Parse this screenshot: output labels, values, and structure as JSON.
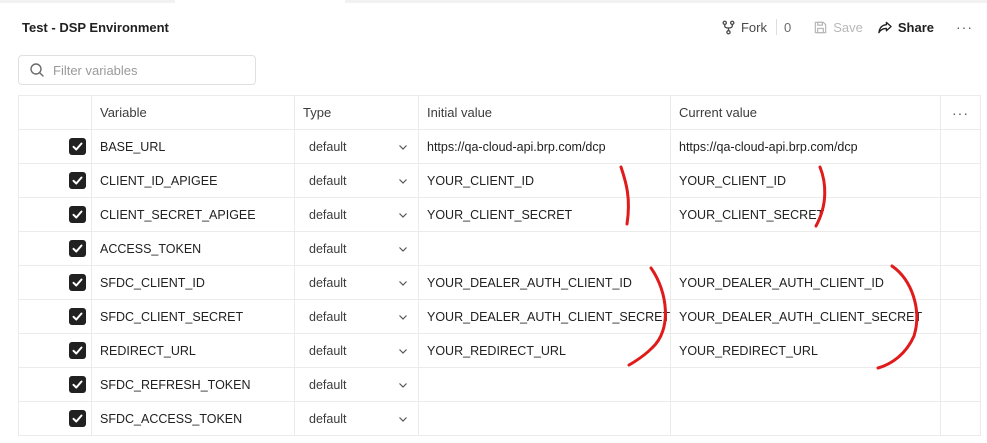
{
  "header": {
    "title": "Test - DSP Environment",
    "fork_label": "Fork",
    "fork_count": "0",
    "save_label": "Save",
    "share_label": "Share",
    "more_label": "···"
  },
  "filter": {
    "placeholder": "Filter variables",
    "value": ""
  },
  "table": {
    "headers": {
      "variable": "Variable",
      "type": "Type",
      "initial": "Initial value",
      "current": "Current value",
      "menu": "···"
    },
    "rows": [
      {
        "enabled": true,
        "name": "BASE_URL",
        "type": "default",
        "initial": "https://qa-cloud-api.brp.com/dcp",
        "current": "https://qa-cloud-api.brp.com/dcp"
      },
      {
        "enabled": true,
        "name": "CLIENT_ID_APIGEE",
        "type": "default",
        "initial": "YOUR_CLIENT_ID",
        "current": "YOUR_CLIENT_ID"
      },
      {
        "enabled": true,
        "name": "CLIENT_SECRET_APIGEE",
        "type": "default",
        "initial": "YOUR_CLIENT_SECRET",
        "current": "YOUR_CLIENT_SECRET"
      },
      {
        "enabled": true,
        "name": "ACCESS_TOKEN",
        "type": "default",
        "initial": "",
        "current": ""
      },
      {
        "enabled": true,
        "name": "SFDC_CLIENT_ID",
        "type": "default",
        "initial": "YOUR_DEALER_AUTH_CLIENT_ID",
        "current": "YOUR_DEALER_AUTH_CLIENT_ID"
      },
      {
        "enabled": true,
        "name": "SFDC_CLIENT_SECRET",
        "type": "default",
        "initial": "YOUR_DEALER_AUTH_CLIENT_SECRET",
        "current": "YOUR_DEALER_AUTH_CLIENT_SECRET"
      },
      {
        "enabled": true,
        "name": "REDIRECT_URL",
        "type": "default",
        "initial": "YOUR_REDIRECT_URL",
        "current": "YOUR_REDIRECT_URL"
      },
      {
        "enabled": true,
        "name": "SFDC_REFRESH_TOKEN",
        "type": "default",
        "initial": "",
        "current": ""
      },
      {
        "enabled": true,
        "name": "SFDC_ACCESS_TOKEN",
        "type": "default",
        "initial": "",
        "current": ""
      }
    ]
  },
  "annotation": {
    "color": "#e01b1b"
  },
  "icons": {
    "fork": "fork-icon",
    "save": "save-icon",
    "share": "share-icon",
    "search": "search-icon",
    "checkbox": "checkmark-icon",
    "dropdown": "chevron-down-icon"
  }
}
